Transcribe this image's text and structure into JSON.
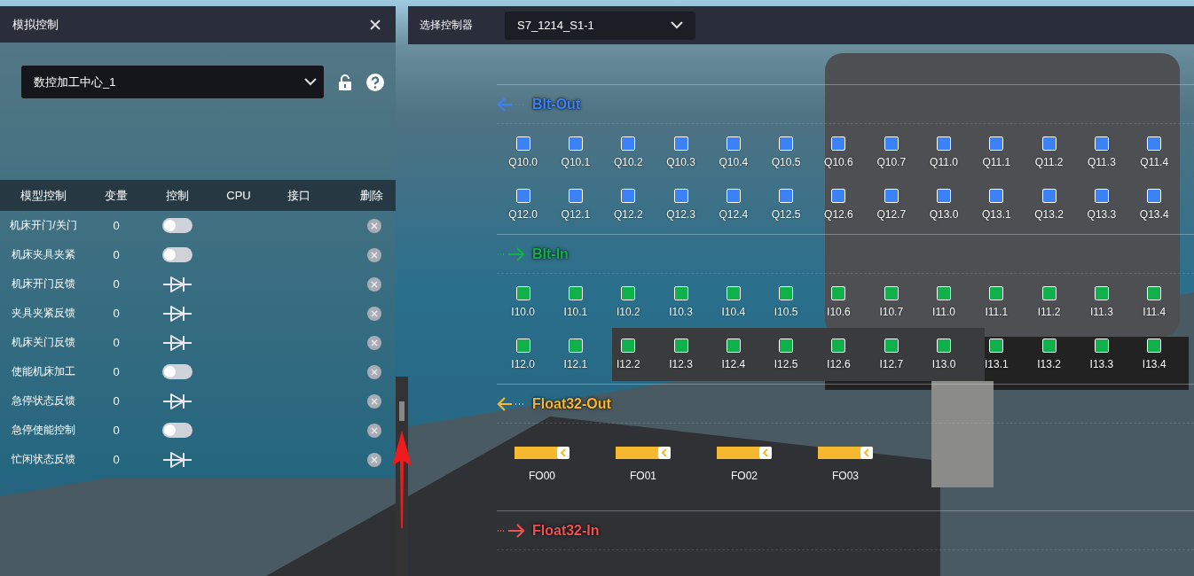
{
  "left_panel": {
    "title": "模拟控制",
    "model_select": {
      "value": "数控加工中心_1"
    },
    "table": {
      "columns": [
        "模型控制",
        "变量",
        "控制",
        "CPU",
        "接口",
        "删除"
      ],
      "rows": [
        {
          "name": "机床开门/关门",
          "value": "0",
          "kind": "switch",
          "on": false
        },
        {
          "name": "机床夹具夹紧",
          "value": "0",
          "kind": "switch",
          "on": false
        },
        {
          "name": "机床开门反馈",
          "value": "0",
          "kind": "indicator"
        },
        {
          "name": "夹具夹紧反馈",
          "value": "0",
          "kind": "indicator"
        },
        {
          "name": "机床关门反馈",
          "value": "0",
          "kind": "indicator"
        },
        {
          "name": "使能机床加工",
          "value": "0",
          "kind": "switch",
          "on": false
        },
        {
          "name": "急停状态反馈",
          "value": "0",
          "kind": "indicator"
        },
        {
          "name": "急停使能控制",
          "value": "0",
          "kind": "switch",
          "on": false
        },
        {
          "name": "忙闲状态反馈",
          "value": "0",
          "kind": "indicator"
        }
      ]
    }
  },
  "right_panel": {
    "controller_label": "选择控制器",
    "controller_select": {
      "value": "S7_1214_S1-1"
    },
    "sections": [
      {
        "title": "Blt-Out",
        "kind": "bit",
        "color": "#3b82f6",
        "rows": [
          [
            {
              "label": "Q10.0",
              "checked": true
            },
            {
              "label": "Q10.1",
              "checked": true
            },
            {
              "label": "Q10.2",
              "checked": true
            },
            {
              "label": "Q10.3",
              "checked": true
            },
            {
              "label": "Q10.4",
              "checked": true
            },
            {
              "label": "Q10.5",
              "checked": true
            },
            {
              "label": "Q10.6",
              "checked": true
            },
            {
              "label": "Q10.7",
              "checked": true
            },
            {
              "label": "Q11.0",
              "checked": true
            },
            {
              "label": "Q11.1",
              "checked": true
            },
            {
              "label": "Q11.2",
              "checked": true
            },
            {
              "label": "Q11.3",
              "checked": true
            },
            {
              "label": "Q11.4",
              "checked": true
            }
          ],
          [
            {
              "label": "Q12.0",
              "checked": true
            },
            {
              "label": "Q12.1",
              "checked": true
            },
            {
              "label": "Q12.2",
              "checked": true
            },
            {
              "label": "Q12.3",
              "checked": true
            },
            {
              "label": "Q12.4",
              "checked": true
            },
            {
              "label": "Q12.5",
              "checked": true
            },
            {
              "label": "Q12.6",
              "checked": true
            },
            {
              "label": "Q12.7",
              "checked": true
            },
            {
              "label": "Q13.0",
              "checked": true
            },
            {
              "label": "Q13.1",
              "checked": true
            },
            {
              "label": "Q13.2",
              "checked": true
            },
            {
              "label": "Q13.3",
              "checked": true
            },
            {
              "label": "Q13.4",
              "checked": true
            }
          ]
        ]
      },
      {
        "title": "Blt-In",
        "kind": "bit",
        "color": "#10b04a",
        "rows": [
          [
            {
              "label": "I10.0",
              "checked": true
            },
            {
              "label": "I10.1",
              "checked": true
            },
            {
              "label": "I10.2",
              "checked": true
            },
            {
              "label": "I10.3",
              "checked": true
            },
            {
              "label": "I10.4",
              "checked": true
            },
            {
              "label": "I10.5",
              "checked": true
            },
            {
              "label": "I10.6",
              "checked": true
            },
            {
              "label": "I10.7",
              "checked": true
            },
            {
              "label": "I11.0",
              "checked": true
            },
            {
              "label": "I11.1",
              "checked": true
            },
            {
              "label": "I11.2",
              "checked": true
            },
            {
              "label": "I11.3",
              "checked": true
            },
            {
              "label": "I11.4",
              "checked": true
            }
          ],
          [
            {
              "label": "I12.0",
              "checked": true
            },
            {
              "label": "I12.1",
              "checked": true
            },
            {
              "label": "I12.2",
              "checked": true
            },
            {
              "label": "I12.3",
              "checked": true
            },
            {
              "label": "I12.4",
              "checked": true
            },
            {
              "label": "I12.5",
              "checked": true
            },
            {
              "label": "I12.6",
              "checked": true
            },
            {
              "label": "I12.7",
              "checked": true
            },
            {
              "label": "I13.0",
              "checked": true
            },
            {
              "label": "I13.1",
              "checked": true
            },
            {
              "label": "I13.2",
              "checked": true
            },
            {
              "label": "I13.3",
              "checked": true
            },
            {
              "label": "I13.4",
              "checked": true
            }
          ]
        ]
      },
      {
        "title": "Float32-Out",
        "kind": "float",
        "color": "#f5b82e",
        "items": [
          {
            "label": "FO00",
            "level": 0.88
          },
          {
            "label": "FO01",
            "level": 0.88
          },
          {
            "label": "FO02",
            "level": 0.88
          },
          {
            "label": "FO03",
            "level": 0.88
          }
        ]
      },
      {
        "title": "Float32-In",
        "kind": "float",
        "color": "#f05252"
      }
    ]
  }
}
